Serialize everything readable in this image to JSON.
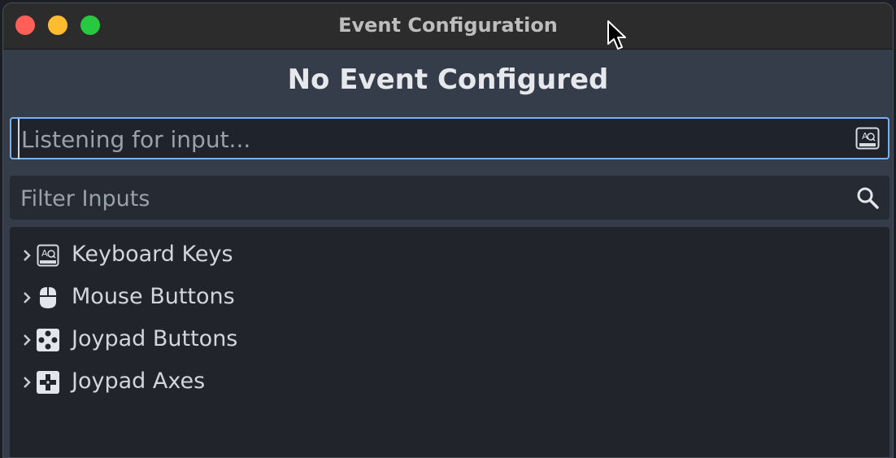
{
  "window": {
    "title": "Event Configuration",
    "heading": "No Event Configured"
  },
  "listen_field": {
    "placeholder": "Listening for input...",
    "icon": "keyboard-icon"
  },
  "filter_field": {
    "placeholder": "Filter Inputs",
    "icon": "search-icon"
  },
  "tree": {
    "items": [
      {
        "label": "Keyboard Keys",
        "icon": "keyboard-icon"
      },
      {
        "label": "Mouse Buttons",
        "icon": "mouse-icon"
      },
      {
        "label": "Joypad Buttons",
        "icon": "joypad-buttons-icon"
      },
      {
        "label": "Joypad Axes",
        "icon": "joypad-axes-icon"
      }
    ]
  },
  "colors": {
    "accent": "#7ab1ea",
    "close": "#fe5f57",
    "minimize": "#febc2e",
    "maximize": "#28c840"
  }
}
